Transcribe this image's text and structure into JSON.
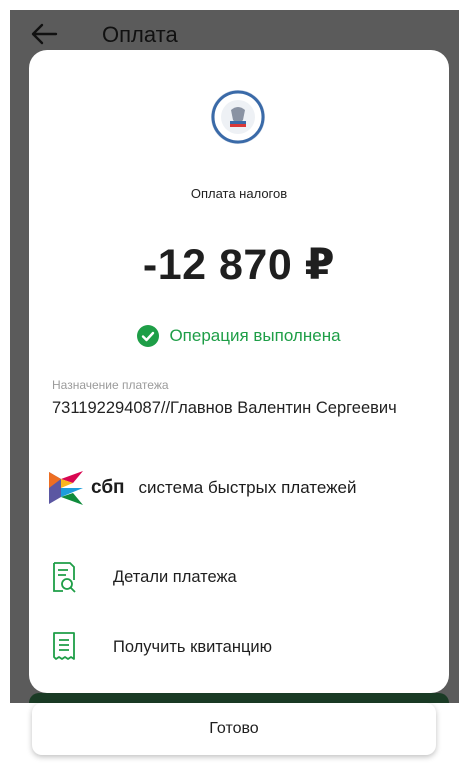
{
  "header": {
    "title": "Оплата",
    "back_icon": "arrow-left-icon"
  },
  "receipt": {
    "recipient_label": "Оплата налогов",
    "amount": "-12 870 ₽",
    "status": "Операция выполнена",
    "purpose_label": "Назначение платежа",
    "purpose_value": "731192294087//Главнов Валентин Сергеевич",
    "sbp_short": "сбп",
    "sbp_full": "система быстрых платежей"
  },
  "actions": [
    {
      "label": "Детали платежа",
      "icon": "document-search-icon"
    },
    {
      "label": "Получить квитанцию",
      "icon": "receipt-icon"
    }
  ],
  "footer": {
    "done_label": "Готово"
  },
  "colors": {
    "accent": "#1e9e47",
    "overlay": "#5b5b5b"
  }
}
